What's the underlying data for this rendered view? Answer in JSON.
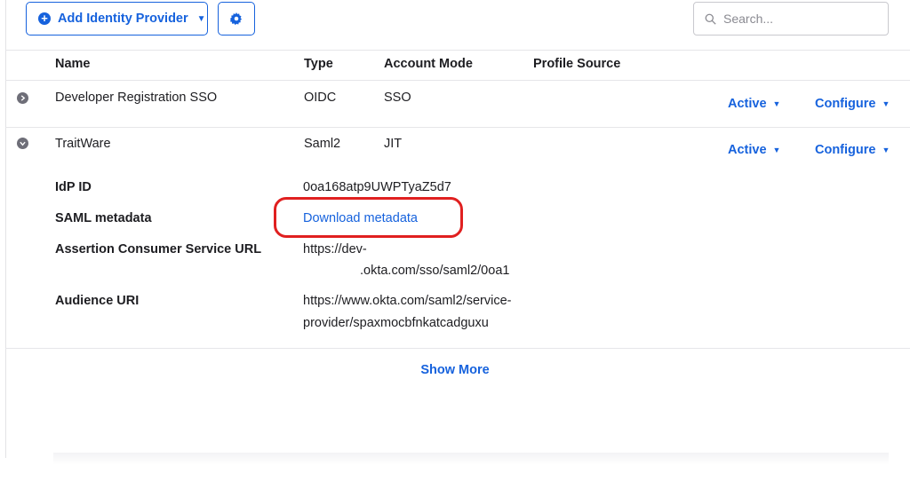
{
  "toolbar": {
    "add_idp_label": "Add Identity Provider",
    "search_placeholder": "Search..."
  },
  "table": {
    "headers": [
      "Name",
      "Type",
      "Account Mode",
      "Profile Source"
    ],
    "rows": [
      {
        "name": "Developer Registration SSO",
        "type": "OIDC",
        "account_mode": "SSO",
        "status": "Active",
        "configure": "Configure",
        "expanded": false
      },
      {
        "name": "TraitWare",
        "type": "Saml2",
        "account_mode": "JIT",
        "status": "Active",
        "configure": "Configure",
        "expanded": true
      }
    ]
  },
  "details": {
    "idp_id_label": "IdP ID",
    "idp_id_value": "0oa168atp9UWPTyaZ5d7",
    "saml_metadata_label": "SAML metadata",
    "saml_metadata_link": "Download metadata",
    "acs_url_label": "Assertion Consumer Service URL",
    "acs_url_line1": "https://dev-",
    "acs_url_line2": ".okta.com/sso/saml2/0oa1",
    "audience_label": "Audience URI",
    "audience_line1": "https://www.okta.com/saml2/service-",
    "audience_line2": "provider/spaxmocbfnkatcadguxu"
  },
  "show_more": "Show More",
  "colors": {
    "accent": "#1662dd",
    "highlight": "#e02020",
    "text": "#1d1d21"
  },
  "icons": [
    "plus-circle-icon",
    "caret-down-icon",
    "gear-icon",
    "search-icon",
    "chevron-right-icon",
    "chevron-down-icon"
  ]
}
